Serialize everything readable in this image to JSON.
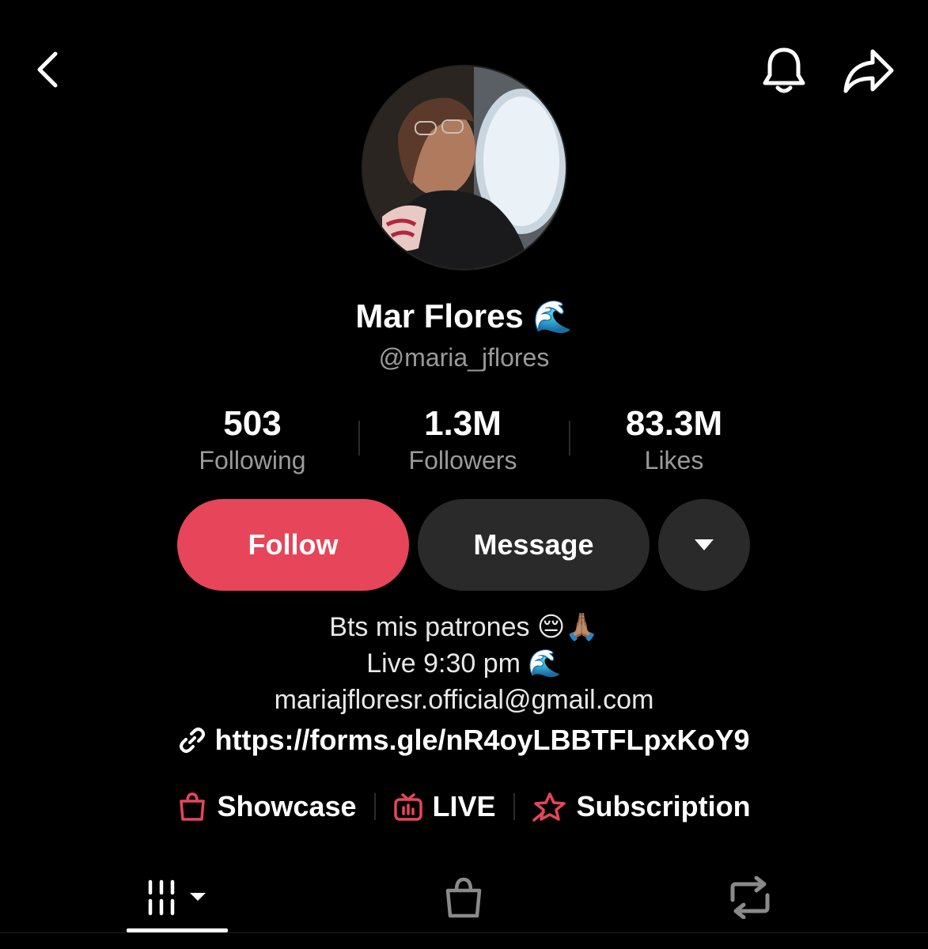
{
  "header": {
    "back_icon": "chevron-left-icon",
    "bell_icon": "bell-icon",
    "share_icon": "share-arrow-icon"
  },
  "profile": {
    "display_name": "Mar Flores",
    "name_emoji": "🌊",
    "username": "@maria_jflores"
  },
  "stats": [
    {
      "value": "503",
      "label": "Following"
    },
    {
      "value": "1.3M",
      "label": "Followers"
    },
    {
      "value": "83.3M",
      "label": "Likes"
    }
  ],
  "actions": {
    "follow_label": "Follow",
    "message_label": "Message",
    "more_icon": "caret-down-icon"
  },
  "bio": {
    "line1": "Bts mis patrones 😔🙏🏽",
    "line2": "Live 9:30 pm 🌊",
    "line3": "mariajfloresr.official@gmail.com",
    "link": "https://forms.gle/nR4oyLBBTFLpxKoY9"
  },
  "features": [
    {
      "icon": "shopping-bag-icon",
      "label": "Showcase"
    },
    {
      "icon": "live-tv-icon",
      "label": "LIVE"
    },
    {
      "icon": "star-subscription-icon",
      "label": "Subscription"
    }
  ],
  "tabs": [
    {
      "icon": "videos-grid-icon",
      "active": true
    },
    {
      "icon": "shopping-bag-icon",
      "active": false
    },
    {
      "icon": "repost-icon",
      "active": false
    }
  ],
  "colors": {
    "background": "#000000",
    "accent": "#e6455a",
    "secondary_button": "#2a2a2a",
    "muted_text": "#9a9a9a"
  }
}
